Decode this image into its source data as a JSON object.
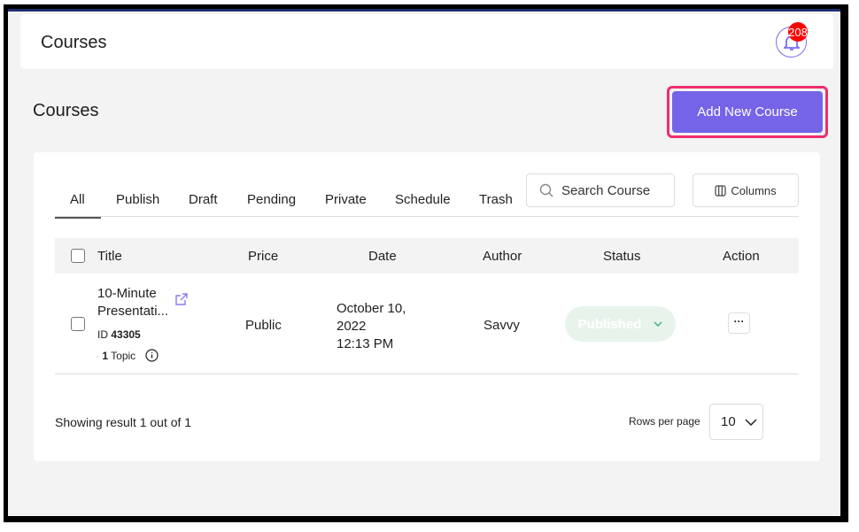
{
  "header": {
    "title": "Courses",
    "notification_count": "208"
  },
  "page": {
    "title": "Courses",
    "add_button": "Add New Course"
  },
  "tabs": [
    "All",
    "Publish",
    "Draft",
    "Pending",
    "Private",
    "Schedule",
    "Trash"
  ],
  "search": {
    "placeholder": "Search Course"
  },
  "columns_button": "Columns",
  "table": {
    "headers": {
      "title": "Title",
      "price": "Price",
      "date": "Date",
      "author": "Author",
      "status": "Status",
      "action": "Action"
    },
    "rows": [
      {
        "title_line1": "10-Minute",
        "title_line2": "Presentati...",
        "id_label": "ID",
        "id": "43305",
        "topic_count": "1",
        "topic_label": "Topic",
        "price": "Public",
        "date_line1": "October 10,",
        "date_line2": "2022",
        "time": "12:13 PM",
        "author": "Savvy",
        "status": "Published",
        "action": "···"
      }
    ]
  },
  "footer": {
    "showing": "Showing result 1 out of 1",
    "rows_label": "Rows per page",
    "rows_value": "10"
  },
  "colors": {
    "accent": "#7564e8",
    "highlight": "#f02d6c",
    "badge": "#ff0000"
  }
}
